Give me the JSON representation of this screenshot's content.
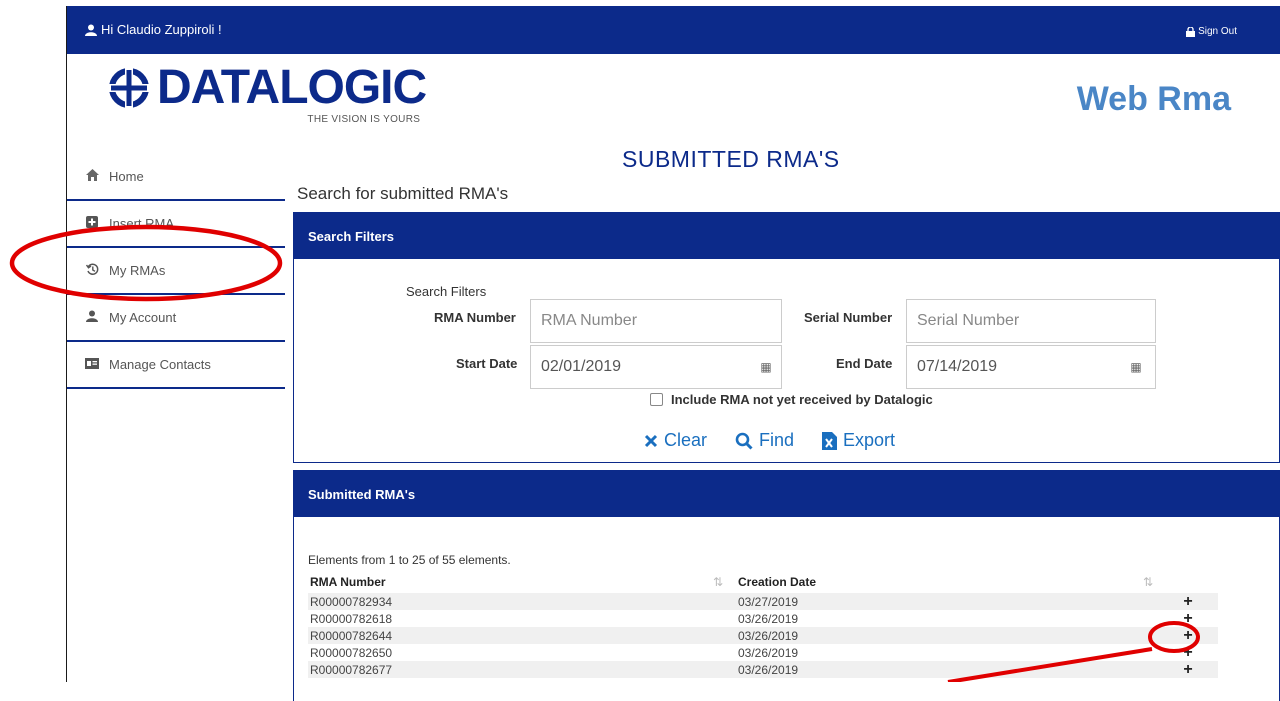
{
  "topbar": {
    "greeting": "Hi Claudio Zuppiroli !",
    "sign_out": "Sign Out"
  },
  "logo": {
    "brand": "DATALOGIC",
    "tagline": "THE VISION IS YOURS"
  },
  "app_title": "Web Rma",
  "sidebar": {
    "items": [
      {
        "label": "Home",
        "icon": "home-icon"
      },
      {
        "label": "Insert RMA",
        "icon": "plus-square-icon"
      },
      {
        "label": "My RMAs",
        "icon": "history-icon"
      },
      {
        "label": "My Account",
        "icon": "user-icon"
      },
      {
        "label": "Manage Contacts",
        "icon": "contact-card-icon"
      }
    ]
  },
  "page": {
    "title": "SUBMITTED RMA'S",
    "subtitle": "Search for submitted RMA's"
  },
  "filters": {
    "panel_title": "Search Filters",
    "section_label": "Search Filters",
    "rma_number": {
      "label": "RMA Number",
      "placeholder": "RMA Number",
      "value": ""
    },
    "serial_number": {
      "label": "Serial Number",
      "placeholder": "Serial Number",
      "value": ""
    },
    "start_date": {
      "label": "Start Date",
      "value": "02/01/2019"
    },
    "end_date": {
      "label": "End Date",
      "value": "07/14/2019"
    },
    "include_not_received": {
      "label": "Include RMA not yet received by Datalogic",
      "checked": false
    },
    "actions": {
      "clear": "Clear",
      "find": "Find",
      "export": "Export"
    }
  },
  "results": {
    "panel_title": "Submitted RMA's",
    "info": "Elements from 1 to 25 of 55 elements.",
    "columns": [
      "RMA Number",
      "Creation Date"
    ],
    "rows": [
      {
        "rma": "R00000782934",
        "date": "03/27/2019"
      },
      {
        "rma": "R00000782618",
        "date": "03/26/2019"
      },
      {
        "rma": "R00000782644",
        "date": "03/26/2019"
      },
      {
        "rma": "R00000782650",
        "date": "03/26/2019"
      },
      {
        "rma": "R00000782677",
        "date": "03/26/2019"
      }
    ]
  },
  "colors": {
    "brand_blue": "#0c2a8a",
    "accent_blue": "#1a6fbf",
    "light_blue": "#4a86c6",
    "annotation_red": "#e00000"
  }
}
